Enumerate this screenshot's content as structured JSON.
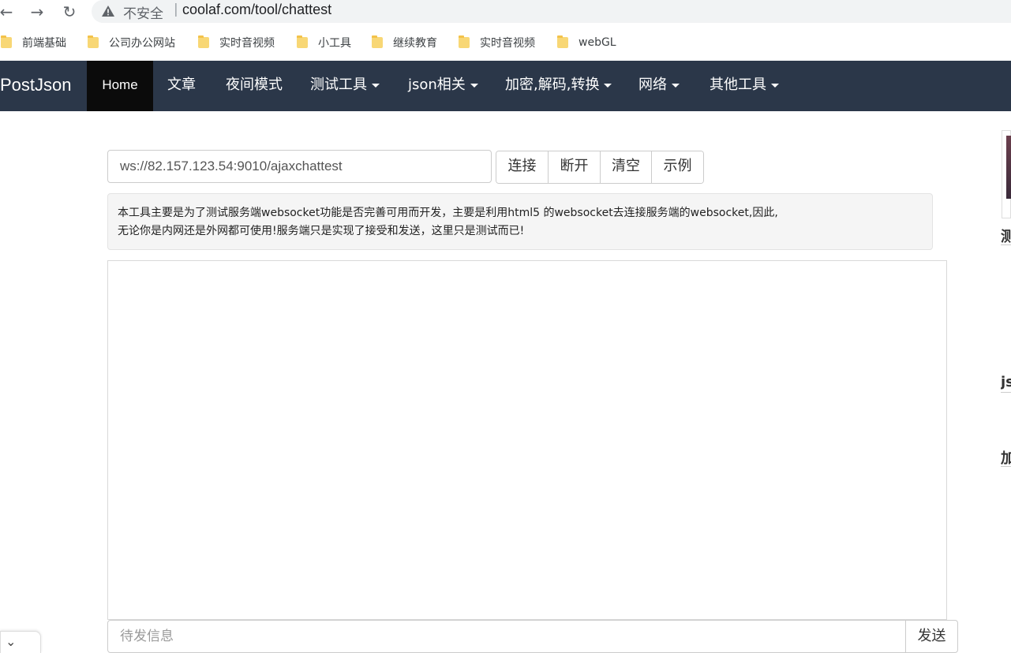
{
  "browser": {
    "security_label": "不安全",
    "separator": "|",
    "url": "coolaf.com/tool/chattest",
    "bookmarks": [
      "前端基础",
      "公司办公网站",
      "实时音视频",
      "小工具",
      "继续教育",
      "实时音视频",
      "webGL"
    ]
  },
  "navbar": {
    "brand": "PostJson",
    "items": [
      {
        "label": "Home",
        "dropdown": false
      },
      {
        "label": "文章",
        "dropdown": false
      },
      {
        "label": "夜间模式",
        "dropdown": false
      },
      {
        "label": "测试工具",
        "dropdown": true
      },
      {
        "label": "json相关",
        "dropdown": true
      },
      {
        "label": "加密,解码,转换",
        "dropdown": true
      },
      {
        "label": "网络",
        "dropdown": true
      },
      {
        "label": "其他工具",
        "dropdown": true
      }
    ]
  },
  "tool": {
    "ws_url": "ws://82.157.123.54:9010/ajaxchattest",
    "buttons": [
      "连接",
      "断开",
      "清空",
      "示例"
    ],
    "notice_line1": "本工具主要是为了测试服务端websocket功能是否完善可用而开发，主要是利用html5 的websocket去连接服务端的websocket,因此,",
    "notice_line2": "无论你是内网还是外网都可使用!服务端只是实现了接受和发送，这里只是测试而已!",
    "message_placeholder": "待发信息",
    "send_label": "发送"
  },
  "sidebar": {
    "headings": [
      "测",
      "js",
      "加"
    ]
  },
  "colors": {
    "navbar_bg": "#2b3749",
    "navbar_active_bg": "#0b0b0b",
    "notice_bg": "#f5f5f5"
  }
}
